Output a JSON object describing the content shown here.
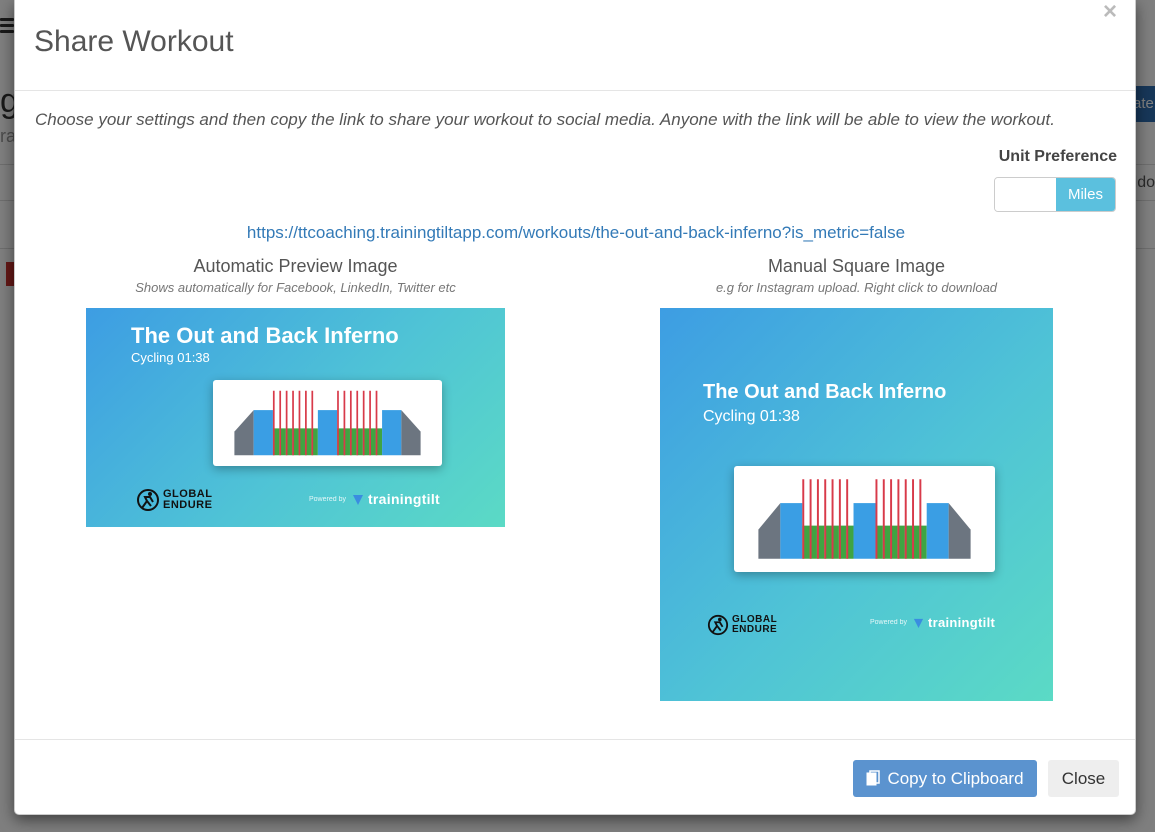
{
  "background": {
    "fragment_1": "g",
    "fragment_2": "ra",
    "fragment_3": "ate",
    "fragment_4": "ddo"
  },
  "modal": {
    "title": "Share Workout",
    "close_symbol": "×",
    "intro_text": "Choose your settings and then copy the link to share your workout to social media. Anyone with the link will be able to view the workout.",
    "unit_preference_label": "Unit Preference",
    "unit_toggle_value": "Miles",
    "share_link": "https://ttcoaching.trainingtiltapp.com/workouts/the-out-and-back-inferno?is_metric=false"
  },
  "automatic_preview": {
    "heading": "Automatic Preview Image",
    "subheading": "Shows automatically for Facebook, LinkedIn, Twitter etc",
    "workout_title": "The Out and Back Inferno",
    "workout_meta": "Cycling 01:38",
    "logo_line1": "GLOBAL",
    "logo_line2": "ENDURE",
    "powered_by": "Powered by",
    "brand": "trainingtilt"
  },
  "manual_square": {
    "heading": "Manual Square Image",
    "subheading": "e.g for Instagram upload. Right click to download",
    "workout_title": "The Out and Back Inferno",
    "workout_meta": "Cycling 01:38",
    "logo_line1": "GLOBAL",
    "logo_line2": "ENDURE",
    "powered_by": "Powered by",
    "brand": "trainingtilt"
  },
  "footer": {
    "copy_button": "Copy to Clipboard",
    "close_button": "Close"
  },
  "colors": {
    "gradient_start": "#3d9de3",
    "gradient_end": "#5bdac5",
    "toggle_active": "#5bc0de",
    "copy_button": "#5b93cf",
    "link": "#337ab7",
    "bar_grey": "#6c7580",
    "bar_blue": "#3a9ee4",
    "bar_green": "#3fa442",
    "bar_red": "#d83a4a"
  },
  "icons": {
    "close": "close-icon",
    "clipboard": "clipboard-icon",
    "runner_logo": "runner-logo-icon",
    "brand_logo": "trainingtilt-logo-icon"
  }
}
